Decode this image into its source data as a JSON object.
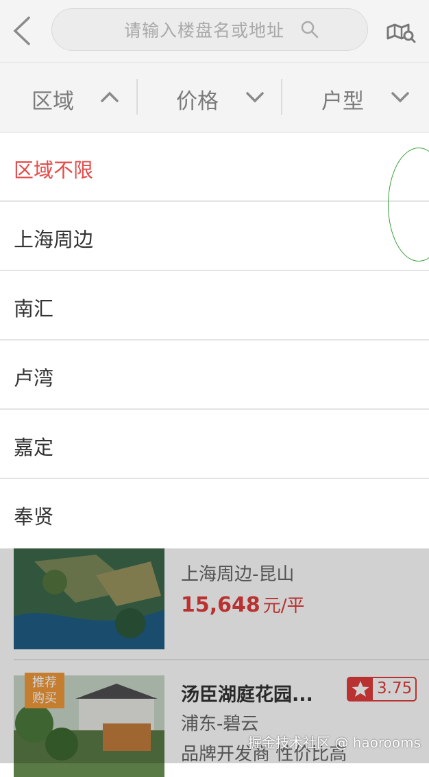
{
  "header": {
    "search_placeholder": "请输入楼盘名或地址"
  },
  "filters": [
    {
      "label": "区域",
      "expanded": true
    },
    {
      "label": "价格",
      "expanded": false
    },
    {
      "label": "户型",
      "expanded": false
    }
  ],
  "dropdown": {
    "options": [
      "区域不限",
      "上海周边",
      "南汇",
      "卢湾",
      "嘉定",
      "奉贤"
    ],
    "selected_index": 0
  },
  "listings": [
    {
      "location": "上海周边-昆山",
      "price": "15,648",
      "price_unit": "元/平"
    },
    {
      "name": "汤臣湖庭花园...",
      "rating": "3.75",
      "location": "浦东-碧云",
      "tags": "品牌开发商 性价比高",
      "badge": "推荐 购买"
    }
  ],
  "watermark": "掘金技术社区 @ haorooms",
  "colors": {
    "accent": "#e64a4a",
    "header_bg": "#f4f4f4",
    "badge": "#f19a3b"
  }
}
